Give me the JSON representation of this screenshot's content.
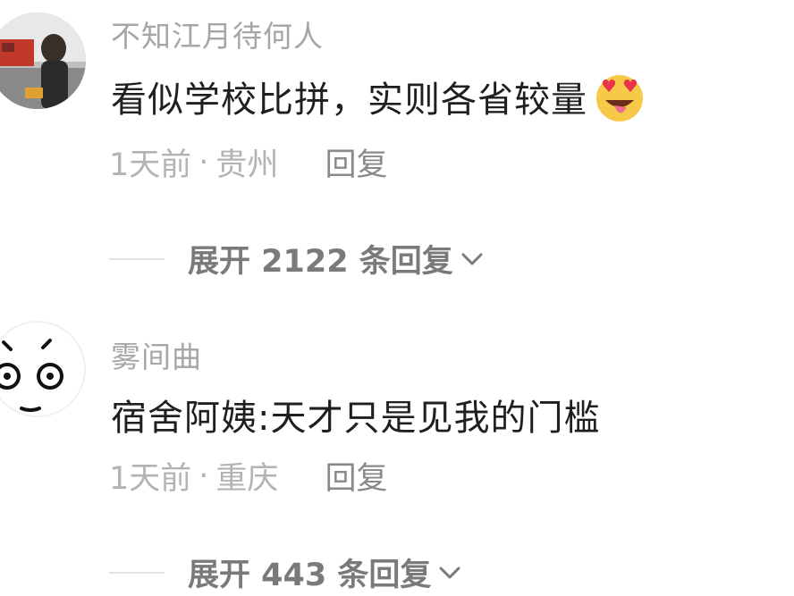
{
  "comments": [
    {
      "username": "不知江月待何人",
      "text": "看似学校比拼，实则各省较量",
      "emoji": "heart-eyes-tongue-emoji",
      "time": "1天前",
      "location": "贵州",
      "reply_label": "回复",
      "expand_label": "展开 2122 条回复"
    },
    {
      "username": "雾间曲",
      "text": "宿舍阿姨:天才只是见我的门槛",
      "time": "1天前",
      "location": "重庆",
      "reply_label": "回复",
      "expand_label": "展开 443 条回复"
    }
  ],
  "separator": "·",
  "colors": {
    "username": "#a6a6a6",
    "text": "#1f1f1f",
    "meta": "#b3b3b3",
    "expand": "#7a7a7a"
  }
}
